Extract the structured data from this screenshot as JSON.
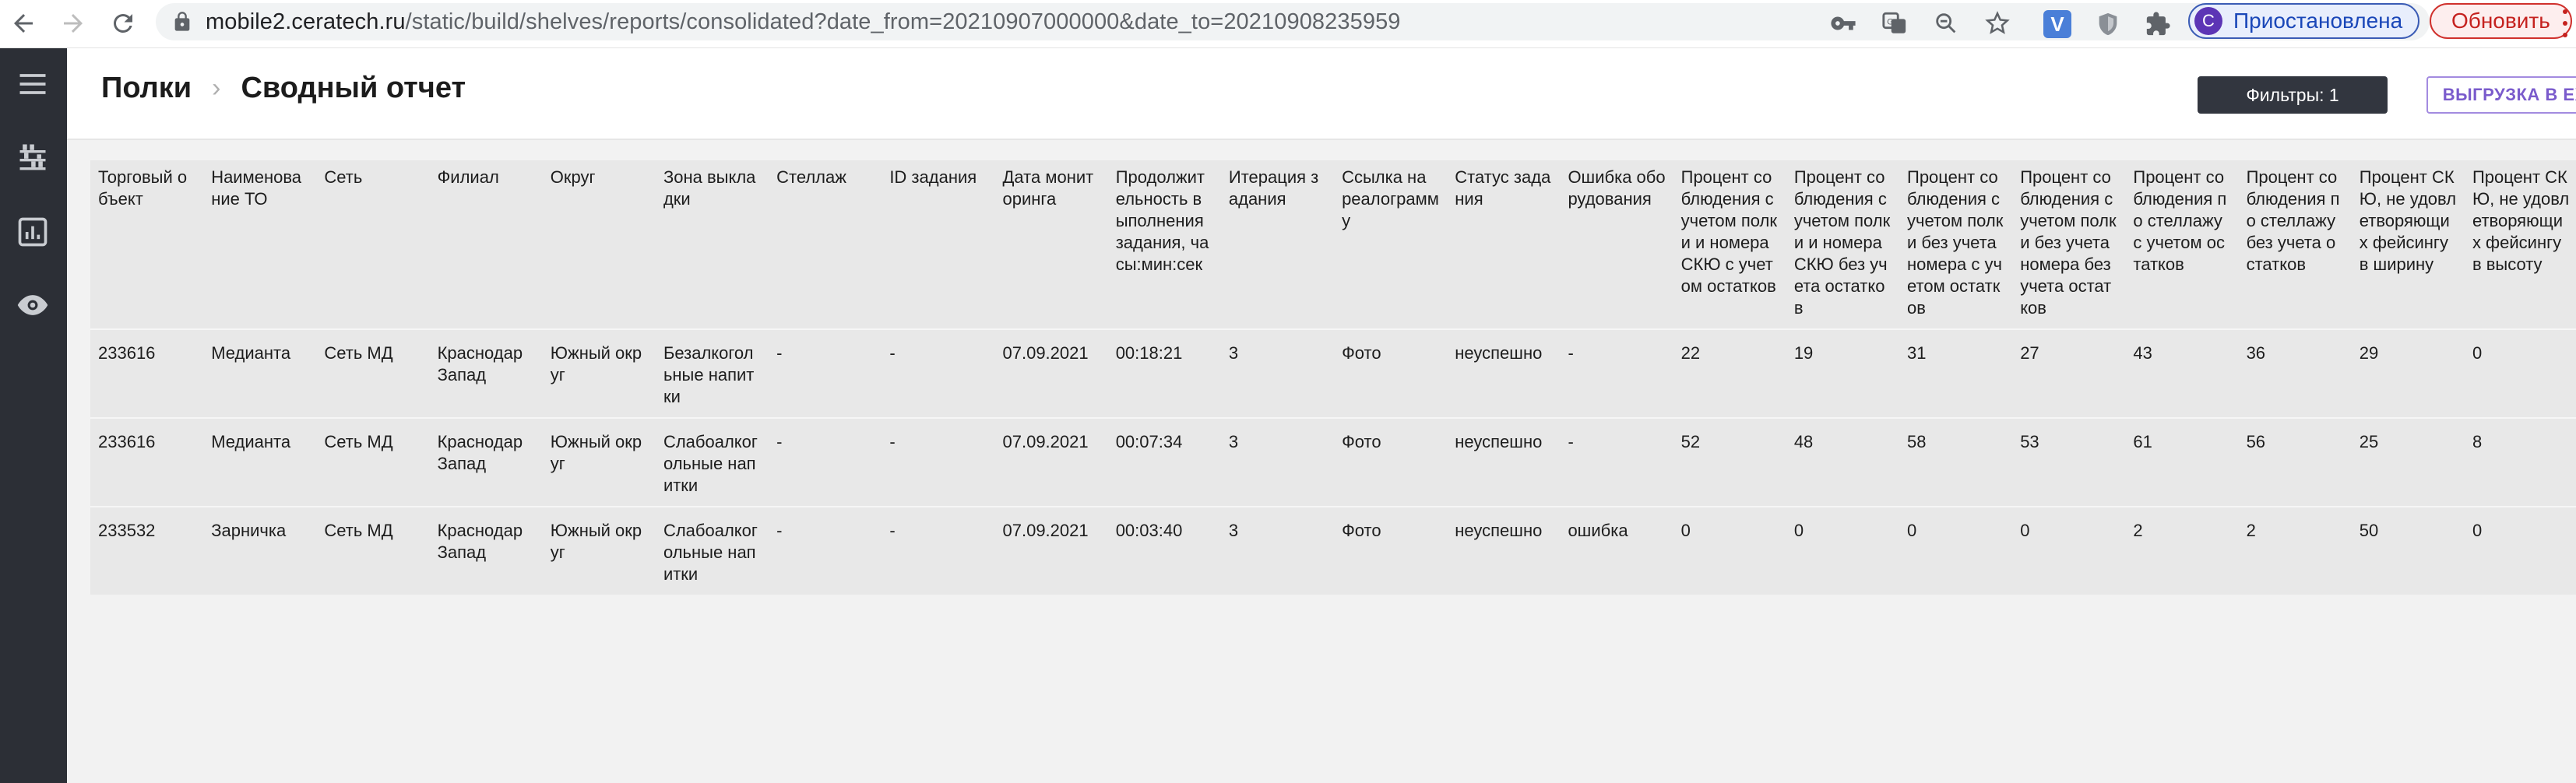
{
  "browser": {
    "url_host": "mobile2.ceratech.ru",
    "url_path": "/static/build/shelves/reports/consolidated?date_from=20210907000000&date_to=20210908235959",
    "profile_initial": "С",
    "profile_label": "Приостановлена",
    "update_label": "Обновить",
    "extension_v_label": "V"
  },
  "header": {
    "breadcrumb_root": "Полки",
    "breadcrumb_separator": "›",
    "page_title": "Сводный отчет",
    "filters_label": "Фильтры: 1",
    "excel_label": "ВЫГРУЗКА В EXCEL"
  },
  "table": {
    "columns": [
      "Торговый объект",
      "Наименование ТО",
      "Сеть",
      "Филиал",
      "Округ",
      "Зона выкладки",
      "Стеллаж",
      "ID задания",
      "Дата мониторинга",
      "Продолжительность выполнения задания, часы:мин:сек",
      "Итерация задания",
      "Ссылка на реалограмму",
      "Статус задания",
      "Ошибка оборудования",
      "Процент соблюдения с учетом полки и номера СКЮ с учетом остатков",
      "Процент соблюдения с учетом полки и номера СКЮ без учета остатков",
      "Процент соблюдения с учетом полки без учета номера с учетом остатков",
      "Процент соблюдения с учетом полки без учета номера без учета остатков",
      "Процент соблюдения по стеллажу с учетом остатков",
      "Процент соблюдения по стеллажу без учета остатков",
      "Процент СКЮ, не удовлетворяющих фейсингу в ширину",
      "Процент СКЮ, не удовлетворяющих фейсингу в высоту"
    ],
    "rows": [
      [
        "233616",
        "Медианта",
        "Сеть МД",
        "Краснодар Запад",
        "Южный округ",
        "Безалкогольные напитки",
        "-",
        "-",
        "07.09.2021",
        "00:18:21",
        "3",
        "Фото",
        "неуспешно",
        "-",
        "22",
        "19",
        "31",
        "27",
        "43",
        "36",
        "29",
        "0"
      ],
      [
        "233616",
        "Медианта",
        "Сеть МД",
        "Краснодар Запад",
        "Южный округ",
        "Слабоалкогольные напитки",
        "-",
        "-",
        "07.09.2021",
        "00:07:34",
        "3",
        "Фото",
        "неуспешно",
        "-",
        "52",
        "48",
        "58",
        "53",
        "61",
        "56",
        "25",
        "8"
      ],
      [
        "233532",
        "Зарничка",
        "Сеть МД",
        "Краснодар Запад",
        "Южный округ",
        "Слабоалкогольные напитки",
        "-",
        "-",
        "07.09.2021",
        "00:03:40",
        "3",
        "Фото",
        "неуспешно",
        "ошибка",
        "0",
        "0",
        "0",
        "0",
        "2",
        "2",
        "50",
        "0"
      ]
    ]
  },
  "colors": {
    "sidebar_bg": "#2c2f36",
    "table_bg": "#e8e8e8",
    "filters_bg": "#32363f",
    "excel_accent": "#7a5bcc"
  },
  "icons": {
    "sidebar": [
      "hamburger-menu-icon",
      "shelves-icon",
      "report-chart-icon",
      "eye-icon"
    ],
    "browser": [
      "back-arrow-icon",
      "forward-arrow-icon",
      "reload-icon",
      "lock-icon",
      "key-icon",
      "translate-icon",
      "zoom-icon",
      "star-icon",
      "shield-icon",
      "puzzle-icon"
    ]
  }
}
